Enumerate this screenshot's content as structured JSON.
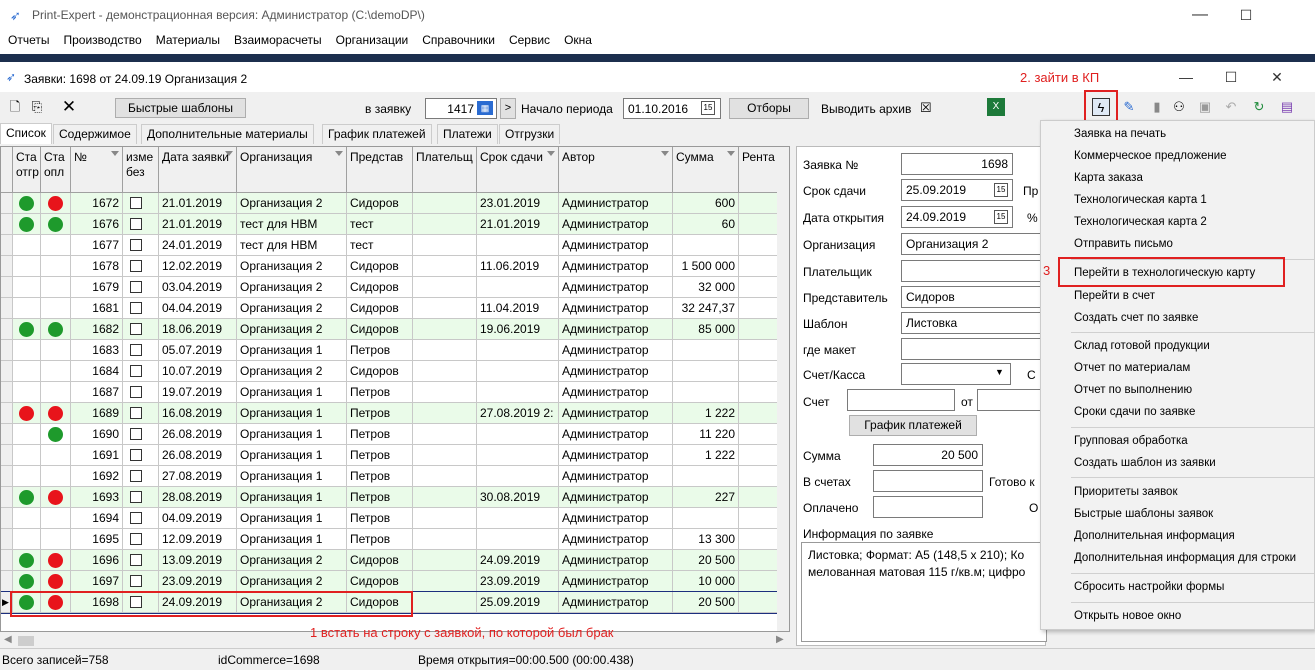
{
  "app": {
    "title": "Print-Expert - демонстрационная версия: Администратор (C:\\demoDP\\)",
    "menu": [
      "Отчеты",
      "Производство",
      "Материалы",
      "Взаиморасчеты",
      "Организации",
      "Справочники",
      "Сервис",
      "Окна"
    ]
  },
  "child": {
    "title": "Заявки: 1698 от 24.09.19  Организация 2",
    "annotation2": "2. зайти в КП"
  },
  "toolbar": {
    "quick_templates": "Быстрые шаблоны",
    "to_order_label": "в заявку",
    "order_value": "1417",
    "period_label": "Начало периода",
    "period_value": "01.10.2016",
    "filters": "Отборы",
    "archive_label": "Выводить архив",
    "archive_mark": "☒"
  },
  "tabs": [
    "Список",
    "Содержимое",
    "Дополнительные материалы",
    "График платежей",
    "Платежи",
    "Отгрузки"
  ],
  "grid": {
    "headers": [
      "Ста отгр",
      "Ста опл",
      "№",
      "изме без",
      "Дата заявки",
      "Организация",
      "Представ",
      "Плательщ",
      "Срок сдачи",
      "Автор",
      "Сумма",
      "Рента"
    ],
    "rows": [
      {
        "s1": "green",
        "s2": "red",
        "no": "1672",
        "date": "21.01.2019",
        "org": "Организация 2",
        "rep": "Сидоров",
        "due": "23.01.2019",
        "author": "Администратор",
        "sum": "600",
        "hl": true
      },
      {
        "s1": "green",
        "s2": "green",
        "no": "1676",
        "date": "21.01.2019",
        "org": "тест для НВМ",
        "rep": "тест",
        "due": "21.01.2019",
        "author": "Администратор",
        "sum": "60",
        "hl": true
      },
      {
        "s1": "",
        "s2": "",
        "no": "1677",
        "date": "24.01.2019",
        "org": "тест для НВМ",
        "rep": "тест",
        "due": "",
        "author": "Администратор",
        "sum": "",
        "hl": false
      },
      {
        "s1": "",
        "s2": "",
        "no": "1678",
        "date": "12.02.2019",
        "org": "Организация 2",
        "rep": "Сидоров",
        "due": "11.06.2019",
        "author": "Администратор",
        "sum": "1 500 000",
        "hl": false
      },
      {
        "s1": "",
        "s2": "",
        "no": "1679",
        "date": "03.04.2019",
        "org": "Организация 2",
        "rep": "Сидоров",
        "due": "",
        "author": "Администратор",
        "sum": "32 000",
        "hl": false
      },
      {
        "s1": "",
        "s2": "",
        "no": "1681",
        "date": "04.04.2019",
        "org": "Организация 2",
        "rep": "Сидоров",
        "due": "11.04.2019",
        "author": "Администратор",
        "sum": "32 247,37",
        "hl": false
      },
      {
        "s1": "green",
        "s2": "green",
        "no": "1682",
        "date": "18.06.2019",
        "org": "Организация 2",
        "rep": "Сидоров",
        "due": "19.06.2019",
        "author": "Администратор",
        "sum": "85 000",
        "hl": true
      },
      {
        "s1": "",
        "s2": "",
        "no": "1683",
        "date": "05.07.2019",
        "org": "Организация 1",
        "rep": "Петров",
        "due": "",
        "author": "Администратор",
        "sum": "",
        "hl": false
      },
      {
        "s1": "",
        "s2": "",
        "no": "1684",
        "date": "10.07.2019",
        "org": "Организация 2",
        "rep": "Сидоров",
        "due": "",
        "author": "Администратор",
        "sum": "",
        "hl": false
      },
      {
        "s1": "",
        "s2": "",
        "no": "1687",
        "date": "19.07.2019",
        "org": "Организация 1",
        "rep": "Петров",
        "due": "",
        "author": "Администратор",
        "sum": "",
        "hl": false
      },
      {
        "s1": "red",
        "s2": "red",
        "no": "1689",
        "date": "16.08.2019",
        "org": "Организация 1",
        "rep": "Петров",
        "due": "27.08.2019 2:",
        "author": "Администратор",
        "sum": "1 222",
        "hl": true
      },
      {
        "s1": "",
        "s2": "green",
        "no": "1690",
        "date": "26.08.2019",
        "org": "Организация 1",
        "rep": "Петров",
        "due": "",
        "author": "Администратор",
        "sum": "11 220",
        "hl": false
      },
      {
        "s1": "",
        "s2": "",
        "no": "1691",
        "date": "26.08.2019",
        "org": "Организация 1",
        "rep": "Петров",
        "due": "",
        "author": "Администратор",
        "sum": "1 222",
        "hl": false
      },
      {
        "s1": "",
        "s2": "",
        "no": "1692",
        "date": "27.08.2019",
        "org": "Организация 1",
        "rep": "Петров",
        "due": "",
        "author": "Администратор",
        "sum": "",
        "hl": false
      },
      {
        "s1": "green",
        "s2": "red",
        "no": "1693",
        "date": "28.08.2019",
        "org": "Организация 1",
        "rep": "Петров",
        "due": "30.08.2019",
        "author": "Администратор",
        "sum": "227",
        "hl": true
      },
      {
        "s1": "",
        "s2": "",
        "no": "1694",
        "date": "04.09.2019",
        "org": "Организация 1",
        "rep": "Петров",
        "due": "",
        "author": "Администратор",
        "sum": "",
        "hl": false
      },
      {
        "s1": "",
        "s2": "",
        "no": "1695",
        "date": "12.09.2019",
        "org": "Организация 1",
        "rep": "Петров",
        "due": "",
        "author": "Администратор",
        "sum": "13 300",
        "hl": false
      },
      {
        "s1": "green",
        "s2": "red",
        "no": "1696",
        "date": "13.09.2019",
        "org": "Организация 2",
        "rep": "Сидоров",
        "due": "24.09.2019",
        "author": "Администратор",
        "sum": "20 500",
        "hl": true
      },
      {
        "s1": "green",
        "s2": "red",
        "no": "1697",
        "date": "23.09.2019",
        "org": "Организация 2",
        "rep": "Сидоров",
        "due": "23.09.2019",
        "author": "Администратор",
        "sum": "10 000",
        "hl": true
      },
      {
        "s1": "green",
        "s2": "red",
        "no": "1698",
        "date": "24.09.2019",
        "org": "Организация 2",
        "rep": "Сидоров",
        "due": "25.09.2019",
        "author": "Администратор",
        "sum": "20 500",
        "hl": true
      }
    ]
  },
  "annotation1": "1   встать на строку с заявкой, по которой был брак",
  "detail": {
    "order_no_label": "Заявка №",
    "order_no": "1698",
    "due_label": "Срок сдачи",
    "due": "25.09.2019",
    "due_side": "Пр",
    "open_label": "Дата открытия",
    "open": "24.09.2019",
    "open_side": "%",
    "org_label": "Организация",
    "org": "Организация 2",
    "payer_label": "Плательщик",
    "rep_label": "Представитель",
    "rep": "Сидоров",
    "tpl_label": "Шаблон",
    "tpl": "Листовка",
    "where_label": "где макет",
    "acc_label": "Счет/Касса",
    "acc_side": "С",
    "inv_label": "Счет",
    "inv_from": "от",
    "pay_sched": "График платежей",
    "sum_label": "Сумма",
    "sum": "20 500",
    "in_inv_label": "В счетах",
    "ready_label": "Готово к",
    "paid_label": "Оплачено",
    "paid_side": "О",
    "info_label": "Информация по заявке",
    "info_text1": "Листовка; Формат: А5 (148,5 х 210); Ко",
    "info_text2": "мелованная матовая 115 г/кв.м; цифро"
  },
  "context_menu": {
    "group1": [
      "Заявка на печать",
      "Коммерческое предложение",
      "Карта заказа",
      "Технологическая карта 1",
      "Технологическая карта 2",
      "Отправить письмо"
    ],
    "group2": [
      "Перейти в технологическую карту",
      "Перейти в счет",
      "Создать счет по заявке"
    ],
    "group3": [
      "Склад готовой продукции",
      "Отчет по материалам",
      "Отчет по выполнению",
      "Сроки сдачи по заявке"
    ],
    "group4": [
      "Групповая обработка",
      "Создать шаблон из заявки"
    ],
    "group5": [
      "Приоритеты заявок",
      "Быстрые шаблоны заявок",
      "Дополнительная информация",
      "Дополнительная информация для строки"
    ],
    "group6": [
      "Сбросить настройки формы"
    ],
    "group7": [
      "Открыть новое окно"
    ],
    "annotation3": "3"
  },
  "status": {
    "records": "Всего записей=758",
    "id": "idCommerce=1698",
    "time": "Время открытия=00:00.500 (00:00.438)"
  },
  "colors": {
    "green": "#1e9a2c",
    "red": "#e8141b",
    "row_hl": "#eafbe9",
    "annotation": "#e02020"
  }
}
